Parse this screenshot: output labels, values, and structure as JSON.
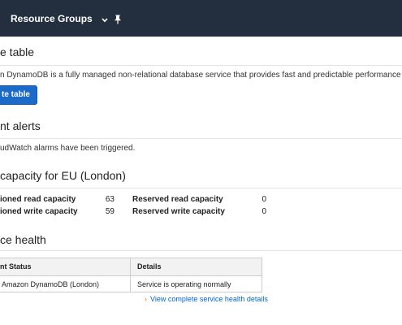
{
  "topbar": {
    "resource_groups_label": "Resource Groups"
  },
  "create_table": {
    "title": "e table",
    "description": "n DynamoDB is a fully managed non-relational database service that provides fast and predictable performance w",
    "button_label": "te table"
  },
  "alerts": {
    "title": "nt alerts",
    "message": "udWatch alarms have been triggered."
  },
  "capacity": {
    "title": "capacity for EU (London)",
    "rows": [
      {
        "label": "ioned read capacity",
        "value": "63",
        "reserved_label": "Reserved read capacity",
        "reserved_value": "0"
      },
      {
        "label": "ioned write capacity",
        "value": "59",
        "reserved_label": "Reserved write capacity",
        "reserved_value": "0"
      }
    ]
  },
  "service_health": {
    "title": "ce health",
    "columns": [
      "nt Status",
      "Details"
    ],
    "rows": [
      {
        "service": "Amazon DynamoDB (London)",
        "details": "Service is operating normally"
      }
    ],
    "link_label": "View complete service health details"
  },
  "colors": {
    "topbar": "#232f3e",
    "primary_button": "#1b6ac9",
    "link": "#0066cc",
    "link_caret": "#e47911"
  },
  "icons": {
    "dropdown": "chevron-down-icon",
    "pin": "pin-icon"
  }
}
